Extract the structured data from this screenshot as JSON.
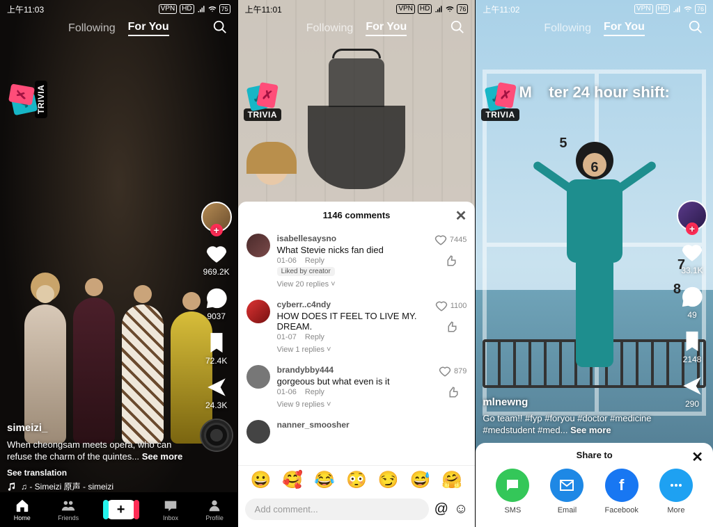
{
  "phones": [
    {
      "status": {
        "time": "上午11:03",
        "vpn": "VPN",
        "hd": "HD",
        "battery": "75"
      },
      "tabs": {
        "following": "Following",
        "foryou": "For You"
      },
      "trivia": "TRIVIA",
      "actions": {
        "likes": "969.2K",
        "comments": "9037",
        "saves": "72.4K",
        "shares": "24.3K"
      },
      "meta": {
        "user": "simeizi_",
        "caption": "When cheongsam meets opera, who can refuse the charm of the quintes...",
        "seemore": "See more",
        "translate": "See translation",
        "music": "♫ - Simeizi  原声 - simeizi"
      },
      "nav": {
        "home": "Home",
        "friends": "Friends",
        "inbox": "Inbox",
        "profile": "Profile"
      }
    },
    {
      "status": {
        "time": "上午11:01",
        "vpn": "VPN",
        "hd": "HD",
        "battery": "76"
      },
      "tabs": {
        "following": "Following",
        "foryou": "For You"
      },
      "trivia": "TRIVIA",
      "commentsHeader": "1146 comments",
      "comments": [
        {
          "user": "isabellesaysno",
          "text": "What Stevie nicks fan died",
          "date": "01-06",
          "reply": "Reply",
          "likes": "7445",
          "liked_by_creator": "Liked by creator",
          "view_replies": "View 20 replies"
        },
        {
          "user": "cyberr..c4ndy",
          "text": "HOW DOES IT FEEL TO LIVE MY. DREAM.",
          "date": "01-07",
          "reply": "Reply",
          "likes": "1100",
          "view_replies": "View 1 replies"
        },
        {
          "user": "brandybby444",
          "text": "gorgeous but what even is it",
          "date": "01-06",
          "reply": "Reply",
          "likes": "879",
          "view_replies": "View 9 replies"
        },
        {
          "user": "nanner_smoosher",
          "text": ""
        }
      ],
      "emojis": [
        "😀",
        "🥰",
        "😂",
        "😳",
        "😏",
        "😅",
        "🤗"
      ],
      "input": {
        "placeholder": "Add comment...",
        "at": "@",
        "smile": "☺"
      }
    },
    {
      "status": {
        "time": "上午11:02",
        "vpn": "VPN",
        "hd": "HD",
        "battery": "76"
      },
      "tabs": {
        "following": "Following",
        "foryou": "For You"
      },
      "trivia": "TRIVIA",
      "overlay_caption": "ter 24 hour shift:",
      "overlay_prefix": "M",
      "nums": {
        "n5": "5",
        "n6": "6",
        "n7": "7",
        "n8": "8"
      },
      "actions": {
        "likes": "33.1K",
        "comments": "49",
        "saves": "2148",
        "shares": "290"
      },
      "meta": {
        "user": "mlnewng",
        "caption": "Go team!! #fyp #foryou #doctor #medicine #medstudent #med... ",
        "seemore": "See more"
      },
      "share": {
        "title": "Share to",
        "apps": [
          {
            "key": "sms",
            "label": "SMS"
          },
          {
            "key": "email",
            "label": "Email"
          },
          {
            "key": "fb",
            "label": "Facebook"
          },
          {
            "key": "more",
            "label": "More"
          }
        ]
      }
    }
  ]
}
